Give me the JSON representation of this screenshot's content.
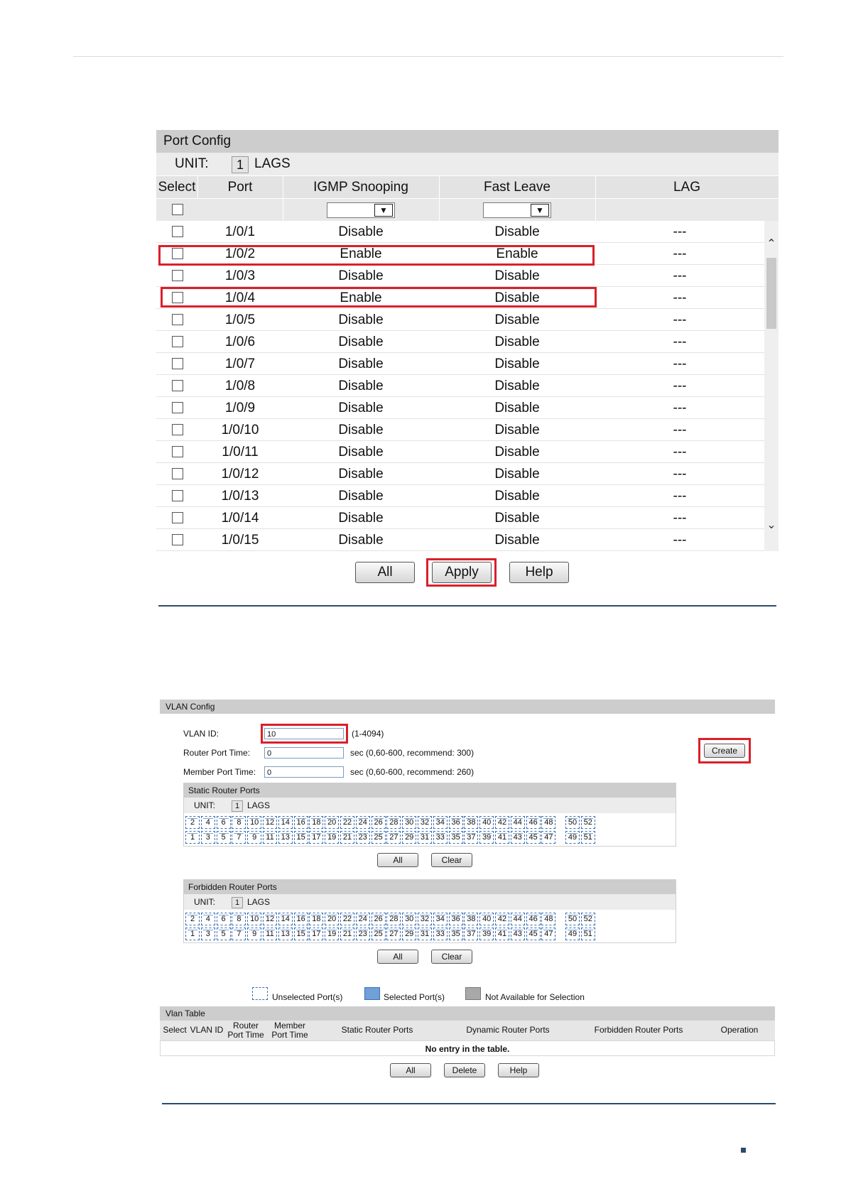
{
  "port_config": {
    "title": "Port Config",
    "unit_label": "UNIT:",
    "unit_value": "1",
    "lags_label": "LAGS",
    "columns": [
      "Select",
      "Port",
      "IGMP Snooping",
      "Fast Leave",
      "LAG"
    ],
    "rows": [
      {
        "port": "1/0/1",
        "igmp": "Disable",
        "fast_leave": "Disable",
        "lag": "---"
      },
      {
        "port": "1/0/2",
        "igmp": "Enable",
        "fast_leave": "Enable",
        "lag": "---"
      },
      {
        "port": "1/0/3",
        "igmp": "Disable",
        "fast_leave": "Disable",
        "lag": "---"
      },
      {
        "port": "1/0/4",
        "igmp": "Enable",
        "fast_leave": "Disable",
        "lag": "---"
      },
      {
        "port": "1/0/5",
        "igmp": "Disable",
        "fast_leave": "Disable",
        "lag": "---"
      },
      {
        "port": "1/0/6",
        "igmp": "Disable",
        "fast_leave": "Disable",
        "lag": "---"
      },
      {
        "port": "1/0/7",
        "igmp": "Disable",
        "fast_leave": "Disable",
        "lag": "---"
      },
      {
        "port": "1/0/8",
        "igmp": "Disable",
        "fast_leave": "Disable",
        "lag": "---"
      },
      {
        "port": "1/0/9",
        "igmp": "Disable",
        "fast_leave": "Disable",
        "lag": "---"
      },
      {
        "port": "1/0/10",
        "igmp": "Disable",
        "fast_leave": "Disable",
        "lag": "---"
      },
      {
        "port": "1/0/11",
        "igmp": "Disable",
        "fast_leave": "Disable",
        "lag": "---"
      },
      {
        "port": "1/0/12",
        "igmp": "Disable",
        "fast_leave": "Disable",
        "lag": "---"
      },
      {
        "port": "1/0/13",
        "igmp": "Disable",
        "fast_leave": "Disable",
        "lag": "---"
      },
      {
        "port": "1/0/14",
        "igmp": "Disable",
        "fast_leave": "Disable",
        "lag": "---"
      },
      {
        "port": "1/0/15",
        "igmp": "Disable",
        "fast_leave": "Disable",
        "lag": "---"
      }
    ],
    "buttons": {
      "all": "All",
      "apply": "Apply",
      "help": "Help"
    }
  },
  "vlan_config": {
    "title": "VLAN Config",
    "vlan_id_label": "VLAN ID:",
    "vlan_id_value": "10",
    "vlan_id_hint": "(1-4094)",
    "router_port_time_label": "Router Port Time:",
    "router_port_time_value": "0",
    "router_port_time_hint": "sec (0,60-600, recommend: 300)",
    "member_port_time_label": "Member Port Time:",
    "member_port_time_value": "0",
    "member_port_time_hint": "sec (0,60-600, recommend: 260)",
    "create_button": "Create",
    "static_router_ports": {
      "title": "Static Router Ports",
      "unit_label": "UNIT:",
      "unit_value": "1",
      "lags_label": "LAGS",
      "all_button": "All",
      "clear_button": "Clear"
    },
    "forbidden_router_ports": {
      "title": "Forbidden Router Ports",
      "unit_label": "UNIT:",
      "unit_value": "1",
      "lags_label": "LAGS",
      "all_button": "All",
      "clear_button": "Clear"
    },
    "ports_even": [
      "2",
      "4",
      "6",
      "8",
      "10",
      "12",
      "14",
      "16",
      "18",
      "20",
      "22",
      "24",
      "26",
      "28",
      "30",
      "32",
      "34",
      "36",
      "38",
      "40",
      "42",
      "44",
      "46",
      "48"
    ],
    "ports_odd": [
      "1",
      "3",
      "5",
      "7",
      "9",
      "11",
      "13",
      "15",
      "17",
      "19",
      "21",
      "23",
      "25",
      "27",
      "29",
      "31",
      "33",
      "35",
      "37",
      "39",
      "41",
      "43",
      "45",
      "47"
    ],
    "sfp_even": [
      "50",
      "52"
    ],
    "sfp_odd": [
      "49",
      "51"
    ],
    "legend": {
      "unselected": "Unselected Port(s)",
      "selected": "Selected Port(s)",
      "not_available": "Not Available for Selection"
    },
    "legend_colors": {
      "unselected": "#ffffff",
      "selected": "#6fa0d8",
      "not_available": "#a8a8a8"
    }
  },
  "vlan_table": {
    "title": "Vlan Table",
    "columns": {
      "select": "Select",
      "vlan_id": "VLAN ID",
      "router_port_time_1": "Router",
      "router_port_time_2": "Port Time",
      "member_port_time_1": "Member",
      "member_port_time_2": "Port Time",
      "static": "Static Router Ports",
      "dynamic": "Dynamic Router Ports",
      "forbidden": "Forbidden Router Ports",
      "operation": "Operation"
    },
    "empty_message": "No entry in the table.",
    "buttons": {
      "all": "All",
      "delete": "Delete",
      "help": "Help"
    }
  },
  "colors": {
    "highlight": "#d9202a",
    "section_line": "#2c4c6c"
  }
}
